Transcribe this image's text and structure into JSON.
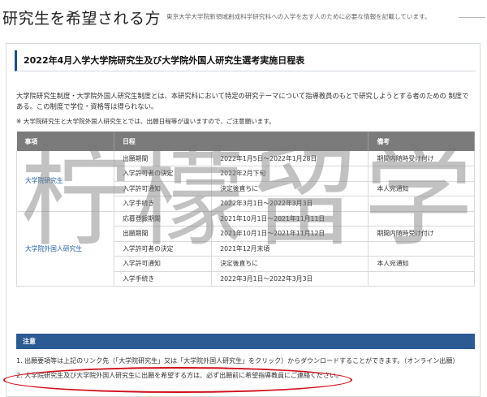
{
  "header": {
    "title": "研究生を希望される方",
    "description": "東京大学大学院新領域創成科学研究科への入学を志す人のために必要な情報を記載しています。"
  },
  "panel": {
    "title": "2022年4月入学大学院研究生及び大学院外国人研究生選考実施日程表",
    "intro": "大学院研究生制度・大学院外国人研究生制度とは、本研究科において特定の研究テーマについて指導教員のもとで研究しようとする者のための 制度である。この制度で学位・資格等は得られない。",
    "note": "※ 大学院研究生と大学院外国人研究生とでは、出願日程等が違いますので、ご注意願います。"
  },
  "table": {
    "headers": [
      "事項",
      "日程",
      "",
      "備考"
    ],
    "groups": [
      {
        "category": "大学院研究生",
        "rows": [
          {
            "item": "出願期間",
            "date": "2022年1月5日～2022年1月28日",
            "remark": "期間内随時受け付け"
          },
          {
            "item": "入学許可者の決定",
            "date": "2022年2月下旬",
            "remark": ""
          },
          {
            "item": "入学許可通知",
            "date": "決定後直ちに",
            "remark": "本人宛通知"
          },
          {
            "item": "入学手続き",
            "date": "2022年3月1日～2022年3月3日",
            "remark": ""
          }
        ]
      },
      {
        "category": "大学院外国人研究生",
        "rows": [
          {
            "item": "応募登録期間",
            "date": "2021年10月1日～2021年11月11日",
            "remark": ""
          },
          {
            "item": "出願期間",
            "date": "2021年10月1日～2021年11月12日",
            "remark": "期間内随時受け付け"
          },
          {
            "item": "入学許可者の決定",
            "date": "2021年12月末頃",
            "remark": ""
          },
          {
            "item": "入学許可通知",
            "date": "決定後直ちに",
            "remark": "本人宛通知"
          },
          {
            "item": "入学手続き",
            "date": "2022年3月1日～2022年3月3日",
            "remark": ""
          }
        ]
      }
    ]
  },
  "notes": {
    "heading": "注意",
    "items": [
      "1. 出願要項等は上記のリンク先（「大学院研究生」又は「大学院外国人研究生」をクリック）からダウンロードすることができます。（オンライン出願）",
      "2. 大学院研究生及び大学院外国人研究生に出願を希望する方は、必ず出願前に希望指導教員にご連絡ください。"
    ]
  },
  "watermark": {
    "text": "柠檬留学"
  },
  "colors": {
    "accent": "#1f4f8a",
    "notes_bar": "#2c5a92",
    "table_header": "#7b7b7b",
    "link": "#1f5fa8",
    "highlight": "#d0101a"
  }
}
